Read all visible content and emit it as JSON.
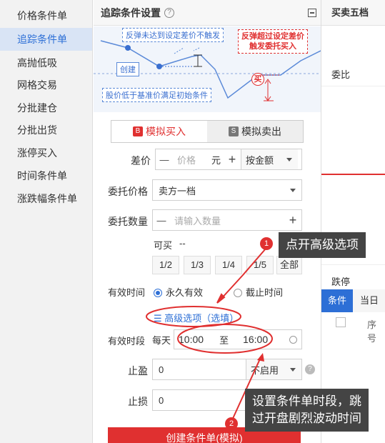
{
  "sidebar": {
    "items": [
      {
        "label": "价格条件单"
      },
      {
        "label": "追踪条件单"
      },
      {
        "label": "高抛低吸"
      },
      {
        "label": "网格交易"
      },
      {
        "label": "分批建仓"
      },
      {
        "label": "分批出货"
      },
      {
        "label": "涨停买入"
      },
      {
        "label": "时间条件单"
      },
      {
        "label": "涨跌幅条件单"
      }
    ],
    "active_index": 1
  },
  "main": {
    "title": "追踪条件设置",
    "help": "?",
    "diagram": {
      "rebound_not_reached": "反弹未达到设定差价不触发",
      "rebound_exceeded_line1": "反弹超过设定差价",
      "rebound_exceeded_line2": "触发委托买入",
      "create": "创建",
      "buy": "买",
      "below_base": "股价低于基准价满足初始条件"
    },
    "tabs": [
      {
        "badge": "B",
        "label": "模拟买入"
      },
      {
        "badge": "S",
        "label": "模拟卖出"
      }
    ],
    "spread": {
      "label": "差价",
      "minus": "—",
      "placeholder": "价格",
      "unit": "元",
      "plus": "+",
      "mode": "按金额"
    },
    "order_price": {
      "label": "委托价格",
      "value": "卖方一档"
    },
    "order_qty": {
      "label": "委托数量",
      "minus": "—",
      "placeholder": "请输入数量",
      "plus": "+"
    },
    "available": {
      "label": "可买",
      "value": "--"
    },
    "fractions": [
      "1/2",
      "1/3",
      "1/4",
      "1/5",
      "全部"
    ],
    "validity": {
      "label": "有效时间",
      "opt1": "永久有效",
      "opt2": "截止时间"
    },
    "advanced": {
      "icon": "☰",
      "label": "高级选项（选填）"
    },
    "period": {
      "label": "有效时段",
      "every_day": "每天",
      "start": "10:00",
      "to": "至",
      "end": "16:00"
    },
    "take_profit": {
      "label": "止盈",
      "value": "0",
      "mode": "不启用"
    },
    "stop_loss": {
      "label": "止损",
      "value": "0"
    },
    "submit": "创建条件单(模拟)"
  },
  "right": {
    "header": "买卖五档",
    "ratio": "委比",
    "limit_down": "跌停",
    "tabs": [
      "条件",
      "当日"
    ],
    "col_seq": "序号"
  },
  "callouts": {
    "c1": {
      "num": "1",
      "text": "点开高级选项"
    },
    "c2": {
      "num": "2",
      "line1": "设置条件单时段，跳",
      "line2": "过开盘剧烈波动时间"
    }
  },
  "colors": {
    "accent_red": "#e03030",
    "accent_blue": "#2d6fd6"
  }
}
